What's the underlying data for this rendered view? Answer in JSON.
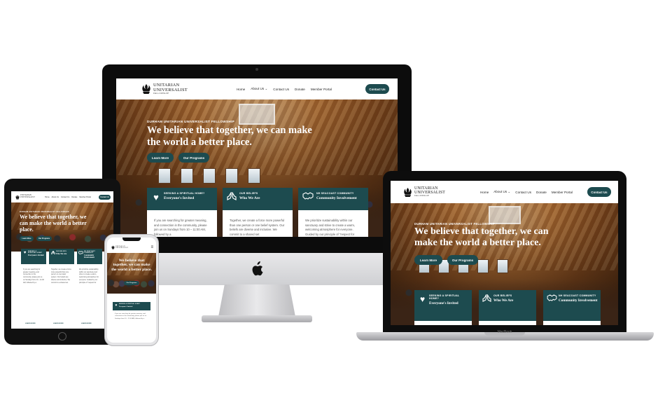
{
  "site": {
    "logo": {
      "line1": "Unitarian",
      "line2": "Universalist",
      "sub": "Fellowship"
    },
    "nav": {
      "items": [
        "Home",
        "About Us",
        "Contact Us",
        "Donate",
        "Member Portal"
      ],
      "cta": "Contact Us",
      "dropdown_icon": "chevron-down-icon"
    },
    "hero": {
      "eyebrow": "Durham Unitarian Universalist Fellowship",
      "headline": "We believe that together, we can make the world a better place.",
      "buttons": [
        "Learn More",
        "Our Programs"
      ]
    },
    "cards": [
      {
        "icon": "heart-icon",
        "kicker": "Seeking a Spiritual Home?",
        "title": "Everyone's Invited",
        "body": "If you are searching for greater meaning, and connection in the community, please join us on Sundays from 10 – 11:00 AM, followed by a",
        "link": "Learn More"
      },
      {
        "icon": "praying-hands-icon",
        "kicker": "Our Beliefs",
        "title": "Who We Are",
        "body": "Together, we create a force more powerful than one person or one belief system. Our beliefs are diverse and inclusive. We commit to a shared set",
        "link": "Learn More"
      },
      {
        "icon": "handshake-icon",
        "kicker": "NH Seacoast Community",
        "title": "Community Involvement",
        "body": "We prioritize sustainability within our sanctuary and strive to create a warm, welcoming atmosphere for everyone. Guided by our principle of \"respect for",
        "link": "Learn More"
      }
    ]
  },
  "devices": {
    "laptop_label": "MacBook"
  },
  "colors": {
    "brand": "#1d4b4f",
    "wood": "#b87333",
    "text": "#222222"
  }
}
